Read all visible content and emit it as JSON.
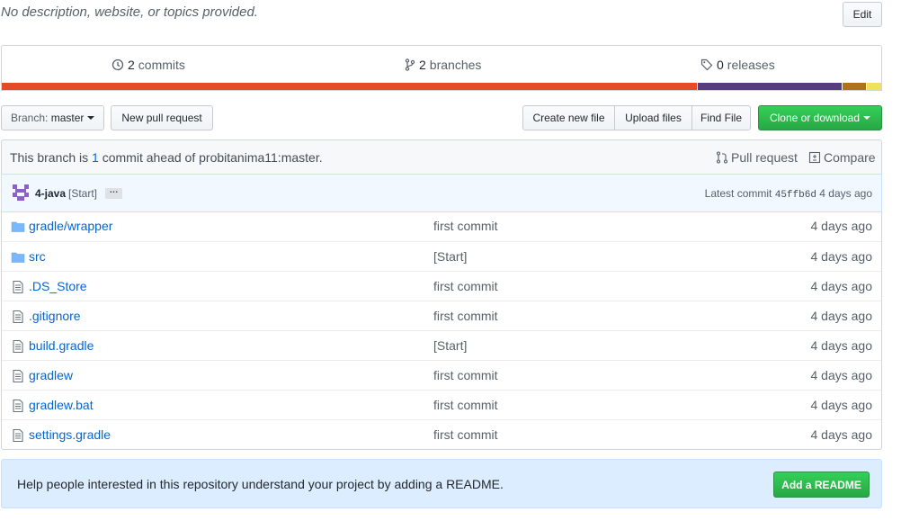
{
  "repo": {
    "description": "No description, website, or topics provided.",
    "edit_label": "Edit"
  },
  "summary": {
    "commits_count": "2",
    "commits_label": "commits",
    "branches_count": "2",
    "branches_label": "branches",
    "releases_count": "0",
    "releases_label": "releases",
    "languages": [
      {
        "color": "#e34c26",
        "share": 0.79
      },
      {
        "color": "#563d7c",
        "share": 0.165
      },
      {
        "color": "#b07219",
        "share": 0.028
      },
      {
        "color": "#f1e05a",
        "share": 0.017
      }
    ]
  },
  "toolbar": {
    "branch_prefix": "Branch:",
    "branch_name": "master",
    "new_pull_request": "New pull request",
    "create_new_file": "Create new file",
    "upload_files": "Upload files",
    "find_file": "Find File",
    "clone_or_download": "Clone or download"
  },
  "branch_info": {
    "prefix": "This branch is",
    "ahead_count": "1",
    "suffix": "commit ahead of probitanima11:master.",
    "pull_request": "Pull request",
    "compare": "Compare"
  },
  "latest_commit": {
    "author": "4-java",
    "message": "[Start]",
    "ellipsis": "…",
    "label": "Latest commit",
    "sha": "45ffb6d",
    "age": "4 days ago"
  },
  "files": [
    {
      "type": "dir",
      "name_prefix": "gradle/",
      "name": "wrapper",
      "message": "first commit",
      "age": "4 days ago"
    },
    {
      "type": "dir",
      "name_prefix": "",
      "name": "src",
      "message": "[Start]",
      "age": "4 days ago"
    },
    {
      "type": "file",
      "name_prefix": "",
      "name": ".DS_Store",
      "message": "first commit",
      "age": "4 days ago"
    },
    {
      "type": "file",
      "name_prefix": "",
      "name": ".gitignore",
      "message": "first commit",
      "age": "4 days ago"
    },
    {
      "type": "file",
      "name_prefix": "",
      "name": "build.gradle",
      "message": "[Start]",
      "age": "4 days ago"
    },
    {
      "type": "file",
      "name_prefix": "",
      "name": "gradlew",
      "message": "first commit",
      "age": "4 days ago"
    },
    {
      "type": "file",
      "name_prefix": "",
      "name": "gradlew.bat",
      "message": "first commit",
      "age": "4 days ago"
    },
    {
      "type": "file",
      "name_prefix": "",
      "name": "settings.gradle",
      "message": "first commit",
      "age": "4 days ago"
    }
  ],
  "readme": {
    "text": "Help people interested in this repository understand your project by adding a README.",
    "button": "Add a README"
  }
}
